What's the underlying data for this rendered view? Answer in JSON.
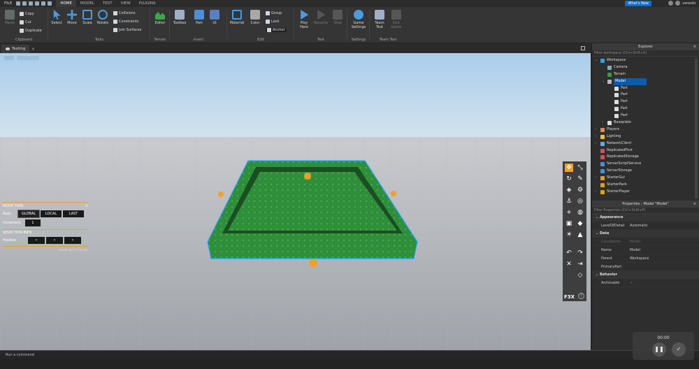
{
  "menubar": {
    "file": "FILE",
    "tabs": [
      "HOME",
      "MODEL",
      "TEST",
      "VIEW",
      "PLUGINS"
    ],
    "active_tab": "HOME",
    "whats_new": "What's New",
    "username": "verestic"
  },
  "ribbon": {
    "clipboard": {
      "paste": "Paste",
      "copy": "Copy",
      "cut": "Cut",
      "duplicate": "Duplicate",
      "label": "Clipboard"
    },
    "tools": {
      "select": "Select",
      "move": "Move",
      "scale": "Scale",
      "rotate": "Rotate",
      "collisions": "Collisions",
      "constraints": "Constraints",
      "join_surfaces": "Join Surfaces",
      "label": "Tools"
    },
    "terrain": {
      "editor": "Editor",
      "label": "Terrain"
    },
    "insert": {
      "toolbox": "Toolbox",
      "part": "Part",
      "ui": "UI",
      "label": "Insert"
    },
    "edit": {
      "material": "Material",
      "color": "Color",
      "group": "Group",
      "lock": "Lock",
      "anchor": "Anchor",
      "label": "Edit"
    },
    "test": {
      "play": "Play",
      "play_line2": "Here",
      "resume": "Resume",
      "stop": "Stop",
      "label": "Test"
    },
    "settings": {
      "game_settings": "Game",
      "game_settings_line2": "Settings",
      "label": "Settings"
    },
    "team_test": {
      "team_test": "Team",
      "team_test_line2": "Test",
      "exit_game": "Exit",
      "exit_game_line2": "Game",
      "label": "Team Test"
    }
  },
  "doc_tab": {
    "title": "Testing"
  },
  "move_tool": {
    "title": "MOVE TOOL",
    "axes_label": "Axes",
    "axes": [
      "GLOBAL",
      "LOCAL",
      "LAST"
    ],
    "increment_label": "Increment",
    "increment_value": "1",
    "selection_info": "SELECTION INFO",
    "position_label": "Position",
    "position_values": [
      "•",
      "•",
      "•"
    ],
    "credit": "made by F3 studio"
  },
  "f3x": {
    "logo": "F3X",
    "help": "?"
  },
  "explorer": {
    "title": "Explorer",
    "filter_placeholder": "Filter workspace (Ctrl+Shift+X)",
    "items": [
      {
        "label": "Workspace",
        "level": 0,
        "expanded": "down",
        "icon": "#3aa0d8"
      },
      {
        "label": "Camera",
        "level": 1,
        "expanded": "",
        "icon": "#8ab"
      },
      {
        "label": "Terrain",
        "level": 1,
        "expanded": "",
        "icon": "#3c9a3c"
      },
      {
        "label": "Model",
        "level": 1,
        "expanded": "down",
        "icon": "#bbb",
        "selected": true
      },
      {
        "label": "Part",
        "level": 2,
        "expanded": "",
        "icon": "#ddd"
      },
      {
        "label": "Part",
        "level": 2,
        "expanded": "",
        "icon": "#ddd"
      },
      {
        "label": "Part",
        "level": 2,
        "expanded": "",
        "icon": "#ddd"
      },
      {
        "label": "Part",
        "level": 2,
        "expanded": "",
        "icon": "#ddd"
      },
      {
        "label": "Part",
        "level": 2,
        "expanded": "",
        "icon": "#ddd"
      },
      {
        "label": "Baseplate",
        "level": 1,
        "expanded": "right",
        "icon": "#ddd"
      },
      {
        "label": "Players",
        "level": 0,
        "expanded": "right",
        "icon": "#d86"
      },
      {
        "label": "Lighting",
        "level": 0,
        "expanded": "right",
        "icon": "#e8c33a"
      },
      {
        "label": "NetworkClient",
        "level": 0,
        "expanded": "right",
        "icon": "#6ad"
      },
      {
        "label": "ReplicatedFirst",
        "level": 0,
        "expanded": "",
        "icon": "#c55"
      },
      {
        "label": "ReplicatedStorage",
        "level": 0,
        "expanded": "",
        "icon": "#c55"
      },
      {
        "label": "ServerScriptService",
        "level": 0,
        "expanded": "",
        "icon": "#4a90d8"
      },
      {
        "label": "ServerStorage",
        "level": 0,
        "expanded": "",
        "icon": "#4a90d8"
      },
      {
        "label": "StarterGui",
        "level": 0,
        "expanded": "right",
        "icon": "#e0a020"
      },
      {
        "label": "StarterPack",
        "level": 0,
        "expanded": "",
        "icon": "#e0a020"
      },
      {
        "label": "StarterPlayer",
        "level": 0,
        "expanded": "right",
        "icon": "#e0a020"
      }
    ]
  },
  "properties": {
    "title": "Properties - Model \"Model\"",
    "filter_placeholder": "Filter Properties (Ctrl+Shift+P)",
    "sections": [
      {
        "name": "Appearance",
        "rows": [
          {
            "name": "LevelOfDetail",
            "value": "Automatic",
            "dim": false
          }
        ]
      },
      {
        "name": "Data",
        "rows": [
          {
            "name": "ClassName",
            "value": "Model",
            "dim": true
          },
          {
            "name": "Name",
            "value": "Model",
            "dim": false
          },
          {
            "name": "Parent",
            "value": "Workspace",
            "dim": false
          },
          {
            "name": "PrimaryPart",
            "value": "",
            "dim": false
          }
        ]
      },
      {
        "name": "Behavior",
        "rows": [
          {
            "name": "Archivable",
            "value": "✓",
            "dim": false
          }
        ]
      }
    ]
  },
  "command_bar": {
    "placeholder": "Run a command"
  },
  "recorder": {
    "time": "00:00",
    "pause": "❚❚",
    "done": "✓"
  },
  "colors": {
    "accent_orange": "#f2a024",
    "selection_blue": "#1ea7ff",
    "model_green": "#2e8f3a",
    "sky": "#b9d6ee"
  }
}
